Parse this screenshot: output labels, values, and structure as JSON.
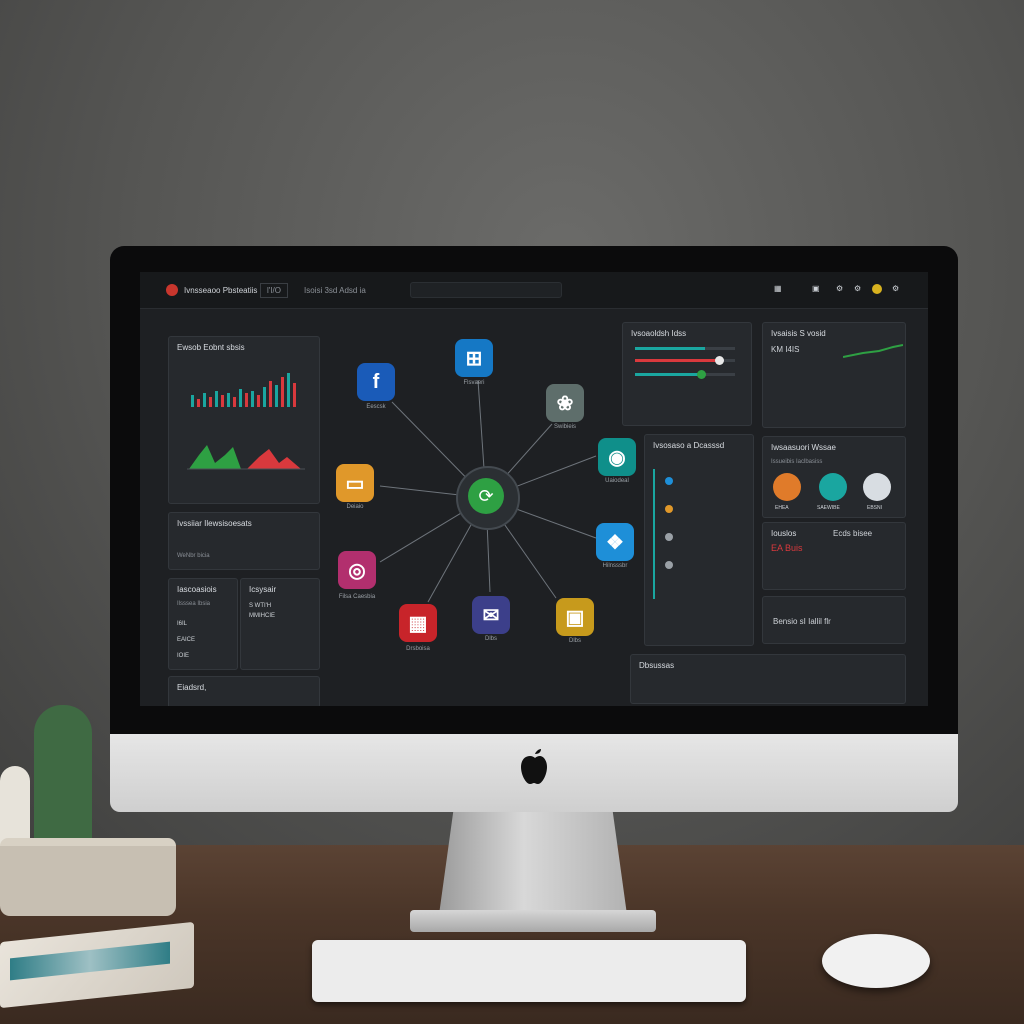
{
  "scene": {
    "colors": {
      "wall": "#5a5a59",
      "desk": "#4a3528",
      "screen_bg": "#1e2023",
      "accent_green": "#2ea043",
      "accent_red": "#d9393d",
      "accent_teal": "#1aa6a0"
    }
  },
  "dashboard": {
    "topbar": {
      "title": "Ivnsseaoo Pbsteatiis",
      "tab_1": "l'I/O",
      "tab_2": "Isoisi 3sd  Adsd ia",
      "icons": [
        "grid-icon",
        "circle-icon",
        "gear-icon",
        "notification-icon",
        "menu-icon"
      ]
    },
    "left_panels": {
      "chart_panel_title": "Ewsob Eobnt sbsis",
      "panel_2_title": "Ivssiiar Ilewsisoesats",
      "panel_2_line": "WeNbr bicia",
      "panel_3_title": "Iascoasiois",
      "panel_3_sub": "Ilsssea Ibsia",
      "panel_3_rows": [
        "I6IL",
        "EAICE",
        "IOIE"
      ],
      "panel_4_title": "Icsysair",
      "panel_4_line_1": "S WTI'H",
      "panel_4_line_2": "MMIHCIE",
      "panel_5_title": "Eiadsrd,"
    },
    "hub": {
      "center_icon": "share-icon",
      "apps": [
        {
          "name": "facebook-icon",
          "glyph": "f",
          "color": "#1a5bb8",
          "label": "Eescsk"
        },
        {
          "name": "grid-app-icon",
          "glyph": "⊞",
          "color": "#1578c5",
          "label": "Flsvaeri"
        },
        {
          "name": "photos-icon",
          "glyph": "❀",
          "color": "#5e6e6b",
          "label": "Swibieis"
        },
        {
          "name": "chat-icon",
          "glyph": "◉",
          "color": "#0f8f8a",
          "label": "Uaiodeal"
        },
        {
          "name": "messenger-icon",
          "glyph": "❖",
          "color": "#1e8fd8",
          "label": "Hilnsssbr"
        },
        {
          "name": "photo-frame-icon",
          "glyph": "▣",
          "color": "#c79a1c",
          "label": "Dlbs"
        },
        {
          "name": "mail-icon",
          "glyph": "✉",
          "color": "#3c3f8a",
          "label": "Dlbs"
        },
        {
          "name": "calendar-icon",
          "glyph": "▦",
          "color": "#c8242a",
          "label": "Drsboisa"
        },
        {
          "name": "camera-icon",
          "glyph": "◎",
          "color": "#b22f6e",
          "label": "Filsa Caesbia"
        },
        {
          "name": "folder-icon",
          "glyph": "▭",
          "color": "#e0982a",
          "label": "Deiaio"
        }
      ]
    },
    "right_panels": {
      "sliders_title": "Ivsoaoldsh Idss",
      "stats_title": "Ivsaisis S vosid",
      "stats_value": "KM I4IS",
      "list_title": "Ivsosaso a Dcasssd",
      "avatars_title": "Iwsaasuori Wssae",
      "avatars_sub": "Issueibis  Iaclbasiss",
      "avatar_labels": [
        "EHEA",
        "SAEWIBE",
        "EBSNI"
      ],
      "panel_a_title": "Iouslos",
      "panel_a_value": "EA Buis",
      "panel_b_title": "Ecds bisee",
      "panel_c_text": "Bensio sI Iallil flr",
      "bottom_title": "Dbsussas"
    }
  }
}
